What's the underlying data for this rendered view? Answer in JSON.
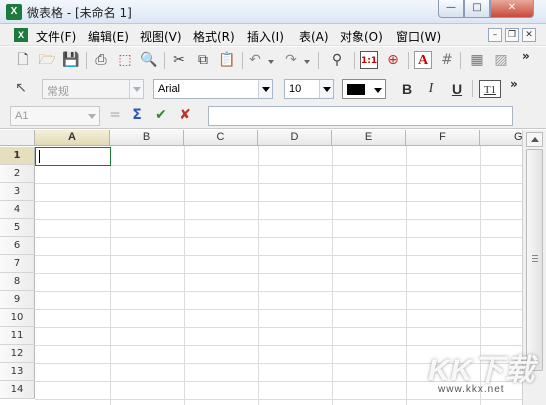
{
  "window": {
    "title": "微表格 - [未命名 1]"
  },
  "menu": {
    "items": [
      "文件(F)",
      "编辑(E)",
      "视图(V)",
      "格式(R)",
      "插入(I)",
      "表(A)",
      "对象(O)",
      "窗口(W)"
    ]
  },
  "toolbar": {
    "more": "»",
    "style_combo": {
      "value": "常规"
    },
    "font_combo": {
      "value": "Arial"
    },
    "size_combo": {
      "value": "10"
    },
    "font_color": "#000000",
    "bold": "B",
    "italic": "I",
    "underline": "U",
    "text_box": "T1",
    "zoom_label": "1:1"
  },
  "formula": {
    "name_box": "A1",
    "input": ""
  },
  "grid": {
    "columns": [
      "A",
      "B",
      "C",
      "D",
      "E",
      "F",
      "G"
    ],
    "rows": [
      "1",
      "2",
      "3",
      "4",
      "5",
      "6",
      "7",
      "8",
      "9",
      "10",
      "11",
      "12",
      "13",
      "14"
    ],
    "active_cell": "A1",
    "active_cell_color": "#1a7a2e"
  },
  "watermark": {
    "text": "KK下载",
    "url": "www.kkx.net"
  }
}
